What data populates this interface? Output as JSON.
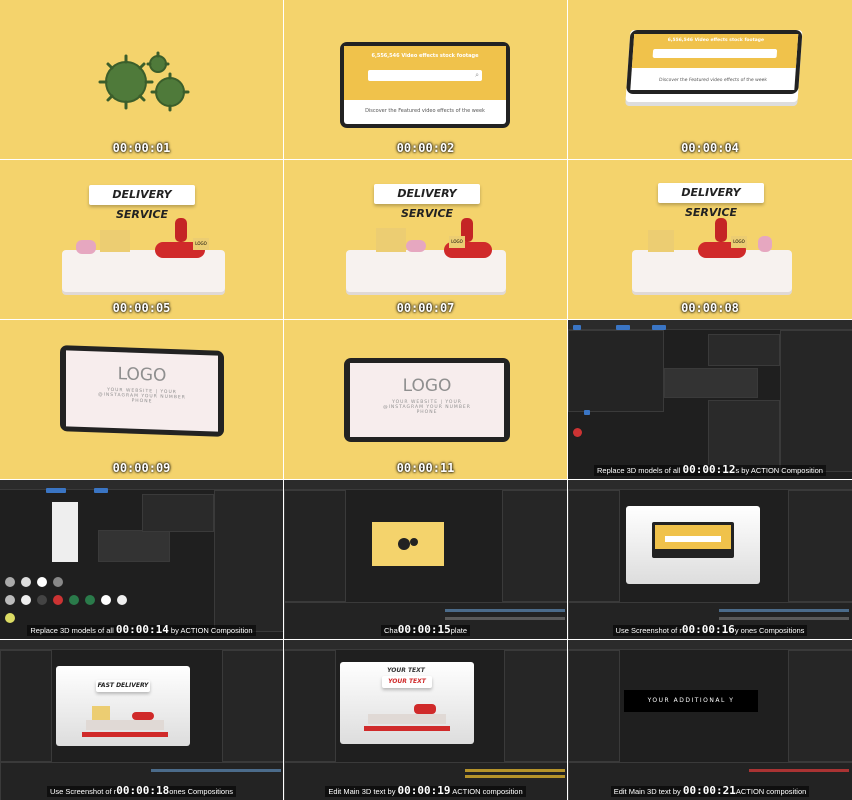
{
  "frames": [
    {
      "time": "00:00:01"
    },
    {
      "time": "00:00:02",
      "screen_title": "6,556,546 Video effects stock footage",
      "screen_text": "Discover the Featured video effects of the week"
    },
    {
      "time": "00:00:04",
      "screen_title": "6,556,546 Video effects stock footage",
      "screen_text": "Discover the Featured video effects of the week"
    },
    {
      "time": "00:00:05",
      "banner": "DELIVERY SERVICE",
      "box_logo": "LOGO"
    },
    {
      "time": "00:00:07",
      "banner": "DELIVERY SERVICE",
      "box_logo": "LOGO"
    },
    {
      "time": "00:00:08",
      "banner": "DELIVERY SERVICE",
      "box_logo": "LOGO"
    },
    {
      "time": "00:00:09",
      "logo": "LOGO",
      "info": "YOUR WEBSITE | YOUR @INSTAGRAM YOUR NUMBER PHONE"
    },
    {
      "time": "00:00:11",
      "logo": "LOGO",
      "info": "YOUR WEBSITE | YOUR @INSTAGRAM YOUR NUMBER PHONE"
    },
    {
      "time": "00:00:12",
      "caption_pre": "Replace 3D models of all ",
      "caption_post": "s by ACTION Composition"
    },
    {
      "time": "00:00:14",
      "caption_pre": "Replace 3D models of all ",
      "caption_post": " by ACTION Composition"
    },
    {
      "time": "00:00:15",
      "caption_pre": "Cha",
      "caption_post": "plate"
    },
    {
      "time": "00:00:16",
      "caption_pre": "Use Screenshot of r",
      "caption_post": "y ones Compositions"
    },
    {
      "time": "00:00:18",
      "caption_pre": "Use Screenshot of r",
      "caption_post": "ones Compositions",
      "banner": "FAST DELIVERY"
    },
    {
      "time": "00:00:19",
      "caption_pre": "Edit Main 3D text by ",
      "caption_post": " ACTION composition",
      "banner_top": "YOUR TEXT",
      "banner": "YOUR TEXT"
    },
    {
      "time": "00:00:21",
      "caption_pre": "Edit Main 3D text by ",
      "caption_post": "ACTION composition",
      "stage_text": "YOUR ADDITIONAL Y"
    }
  ],
  "colors": {
    "yellow": "#f4d36c",
    "dark_ui": "#1f1f1f",
    "accent_blue": "#3a75c4",
    "virus_green": "#4f7a3a",
    "scooter_red": "#d02a2a"
  }
}
